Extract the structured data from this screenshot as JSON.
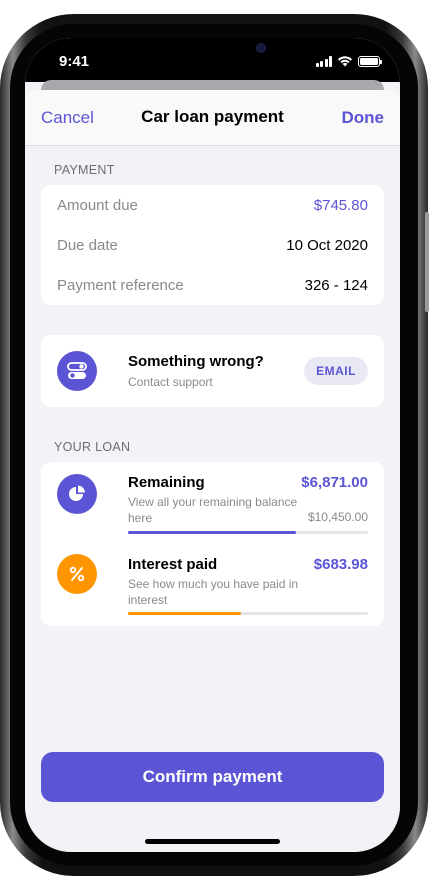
{
  "status_bar": {
    "time": "9:41"
  },
  "nav": {
    "cancel": "Cancel",
    "title": "Car loan payment",
    "done": "Done"
  },
  "payment": {
    "header": "PAYMENT",
    "rows": [
      {
        "label": "Amount due",
        "value": "$745.80"
      },
      {
        "label": "Due date",
        "value": "10 Oct 2020"
      },
      {
        "label": "Payment reference",
        "value": "326 - 124"
      }
    ]
  },
  "support": {
    "title": "Something wrong?",
    "subtitle": "Contact support",
    "button": "EMAIL",
    "icon": "toggle-icon"
  },
  "loan": {
    "header": "YOUR LOAN",
    "items": [
      {
        "title": "Remaining",
        "amount": "$6,871.00",
        "description": "View all your remaining balance here",
        "total": "$10,450.00",
        "progress": 0.7,
        "icon": "pie-chart-icon",
        "color": "#5b55d6"
      },
      {
        "title": "Interest paid",
        "amount": "$683.98",
        "description": "See how much you have paid in interest",
        "progress": 0.47,
        "icon": "percent-icon",
        "color": "#ff9500"
      }
    ]
  },
  "confirm": {
    "label": "Confirm payment"
  },
  "colors": {
    "accent": "#5b55d6",
    "orange": "#ff9500",
    "background": "#f2f2f7"
  }
}
